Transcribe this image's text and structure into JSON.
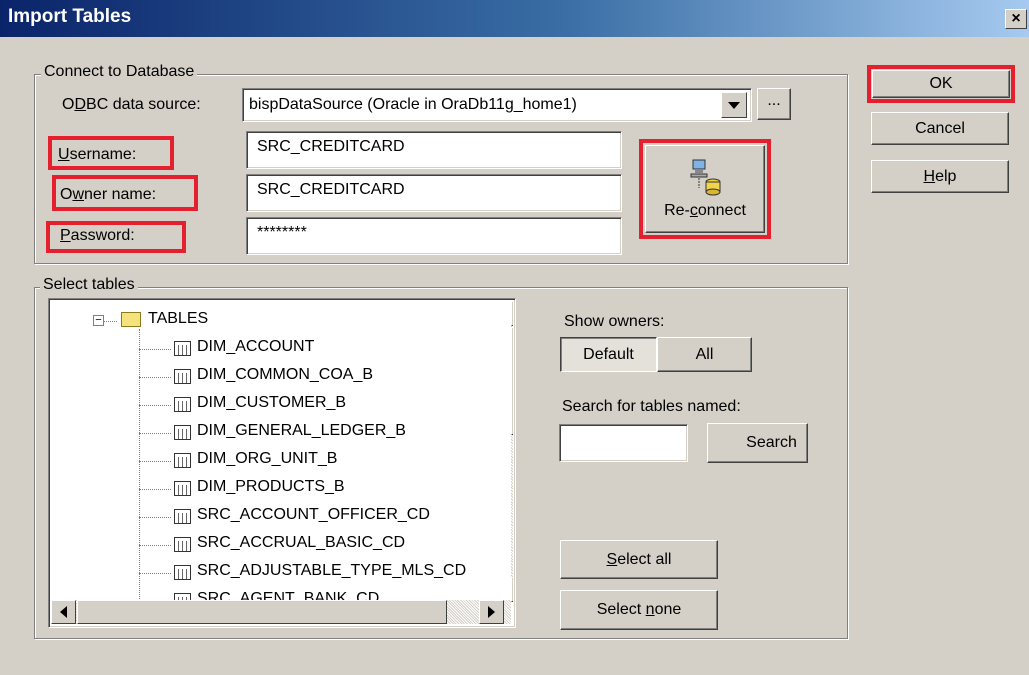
{
  "window": {
    "title": "Import Tables",
    "close_label": "×"
  },
  "connect": {
    "group_label": "Connect to Database",
    "odbc_label_pre": "O",
    "odbc_label_u": "D",
    "odbc_label_post": "BC data source:",
    "odbc_value": "bispDataSource (Oracle in OraDb11g_home1)",
    "browse_label": "...",
    "username_label_u": "U",
    "username_label_post": "sername:",
    "username_value": "SRC_CREDITCARD",
    "owner_label_pre": "O",
    "owner_label_u": "w",
    "owner_label_post": "ner name:",
    "owner_value": "SRC_CREDITCARD",
    "password_label_u": "P",
    "password_label_post": "assword:",
    "password_value": "********",
    "reconnect_pre": "Re-",
    "reconnect_u": "c",
    "reconnect_post": "onnect"
  },
  "actions": {
    "ok": "OK",
    "cancel": "Cancel",
    "help_u": "H",
    "help_post": "elp"
  },
  "select": {
    "group_label": "Select tables",
    "tree_root": "TABLES",
    "tables": [
      "DIM_ACCOUNT",
      "DIM_COMMON_COA_B",
      "DIM_CUSTOMER_B",
      "DIM_GENERAL_LEDGER_B",
      "DIM_ORG_UNIT_B",
      "DIM_PRODUCTS_B",
      "SRC_ACCOUNT_OFFICER_CD",
      "SRC_ACCRUAL_BASIC_CD",
      "SRC_ADJUSTABLE_TYPE_MLS_CD",
      "SRC_AGENT_BANK_CD"
    ],
    "show_owners_label": "Show owners:",
    "default_label": "Default",
    "all_label": "All",
    "search_label": "Search for tables named:",
    "search_value": "",
    "search_button": "Search",
    "select_all_u": "S",
    "select_all_post": "elect all",
    "select_none_pre": "Select ",
    "select_none_u": "n",
    "select_none_post": "one"
  },
  "colors": {
    "highlight": "#e5202e",
    "titlebar": "#0a246a",
    "dialog": "#d4d0c8"
  },
  "icons": {
    "reconnect": "network-database-icon",
    "folder": "folder-icon",
    "table": "table-icon"
  }
}
